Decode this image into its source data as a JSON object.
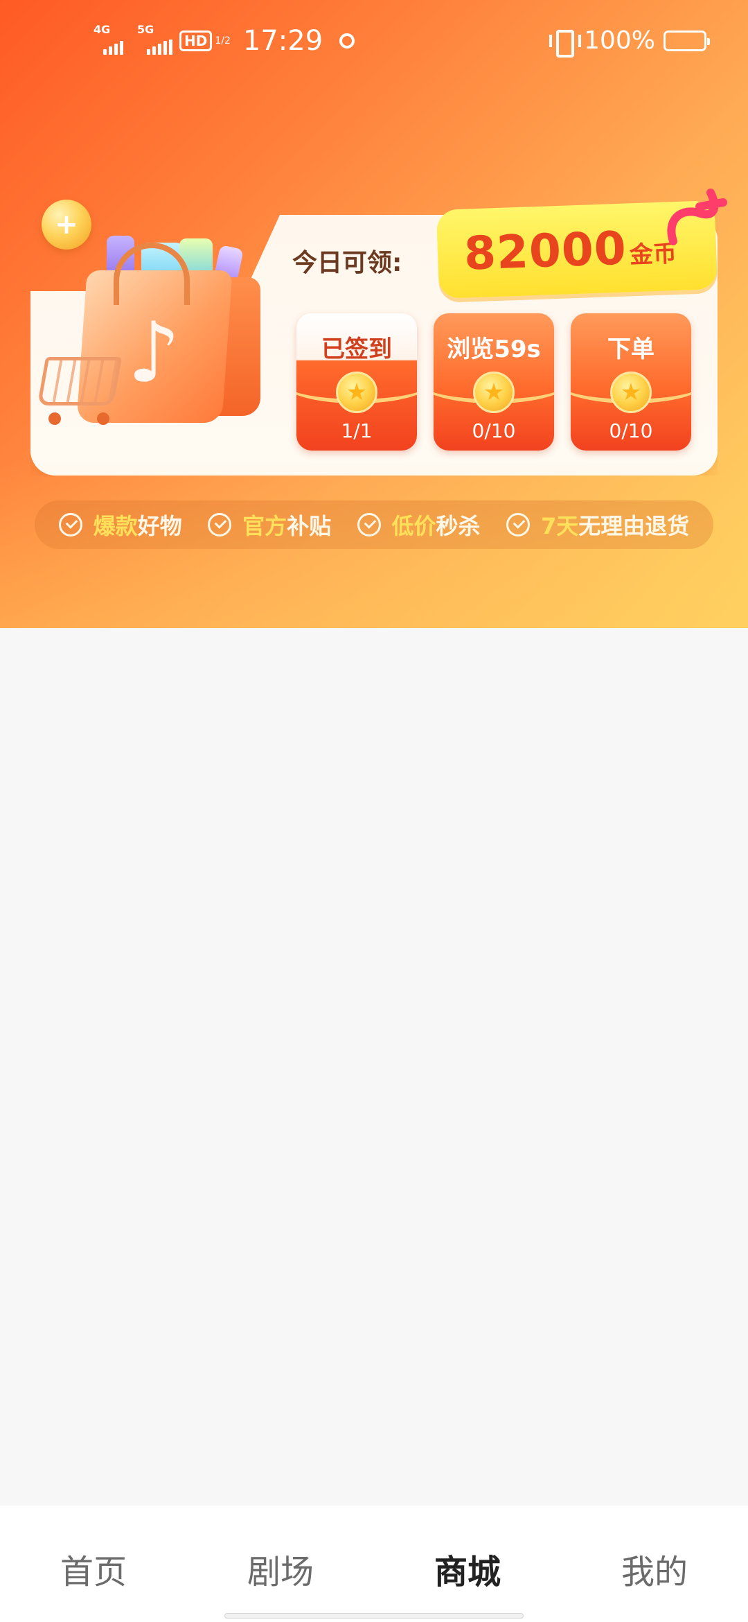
{
  "status_bar": {
    "network1": "4G",
    "network2": "5G",
    "hd": "HD",
    "hd_sub": "1/2",
    "time": "17:29",
    "battery_pct": "100%",
    "battery_level": 1.0
  },
  "hero": {
    "today_label": "今日可领:",
    "coin_amount": "82000",
    "coin_unit": "金币",
    "tasks": [
      {
        "title": "已签到",
        "progress": "1/1",
        "done": true
      },
      {
        "title": "浏览59s",
        "progress": "0/10",
        "done": false
      },
      {
        "title": "下单",
        "progress": "0/10",
        "done": false
      }
    ]
  },
  "benefits": [
    {
      "highlight": "爆款",
      "text": "好物"
    },
    {
      "highlight": "官方",
      "text": "补贴"
    },
    {
      "highlight": "低价",
      "text": "秒杀"
    },
    {
      "highlight": "7天",
      "text": "无理由退货"
    }
  ],
  "nav": {
    "items": [
      "首页",
      "剧场",
      "商城",
      "我的"
    ],
    "active_index": 2
  },
  "colors": {
    "hero_start": "#ff5a24",
    "hero_end": "#ffd563",
    "coin_text": "#e8451e",
    "pill": "#ffe02f",
    "highlight": "#ffe45a"
  }
}
